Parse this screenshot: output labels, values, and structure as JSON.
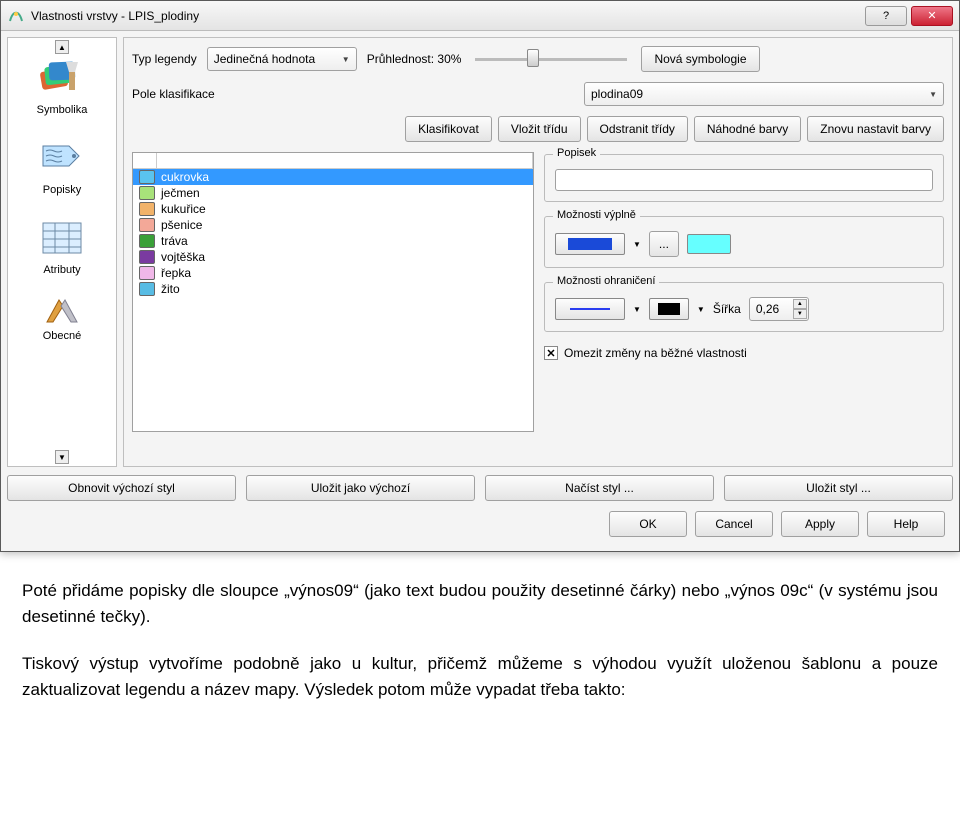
{
  "window": {
    "title": "Vlastnosti vrstvy - LPIS_plodiny",
    "help_glyph": "?",
    "close_glyph": "✕"
  },
  "sidebar": {
    "items": [
      {
        "label": "Symbolika"
      },
      {
        "label": "Popisky"
      },
      {
        "label": "Atributy"
      },
      {
        "label": "Obecné"
      }
    ]
  },
  "legend": {
    "type_label": "Typ legendy",
    "type_value": "Jedinečná hodnota",
    "transparency_label": "Průhlednost: 30%",
    "new_sym_btn": "Nová symbologie",
    "class_field_label": "Pole klasifikace",
    "class_field_value": "plodina09",
    "buttons": {
      "classify": "Klasifikovat",
      "add_class": "Vložit třídu",
      "remove_classes": "Odstranit třídy",
      "random_colors": "Náhodné barvy",
      "reset_colors": "Znovu nastavit barvy"
    },
    "classes": [
      {
        "label": "cukrovka",
        "color": "#5ac3ee"
      },
      {
        "label": "ječmen",
        "color": "#a8e27a"
      },
      {
        "label": "kukuřice",
        "color": "#f2b36a"
      },
      {
        "label": "pšenice",
        "color": "#f3a898"
      },
      {
        "label": "tráva",
        "color": "#3aa038"
      },
      {
        "label": "vojtěška",
        "color": "#7a3aa0"
      },
      {
        "label": "řepka",
        "color": "#f0b7e8"
      },
      {
        "label": "žito",
        "color": "#58bce4"
      }
    ]
  },
  "detail": {
    "popisek_label": "Popisek",
    "fill_label": "Možnosti výplně",
    "fill_color": "#1a4ad8",
    "fill_more": "...",
    "fill_preview": "#66ffff",
    "outline_label": "Možnosti ohraničení",
    "outline_color": "#2a3df0",
    "width_label": "Šířka",
    "width_value": "0,26",
    "black_swatch": "#000000",
    "limit_label": "Omezit změny na běžné vlastnosti"
  },
  "style_buttons": {
    "restore": "Obnovit výchozí styl",
    "save_default": "Uložit jako výchozí",
    "load": "Načíst styl ...",
    "save": "Uložit styl ..."
  },
  "dialog_buttons": {
    "ok": "OK",
    "cancel": "Cancel",
    "apply": "Apply",
    "help": "Help"
  },
  "doc": {
    "p1": "Poté přidáme popisky dle sloupce „výnos09“ (jako text budou použity desetinné čárky) nebo „výnos 09c“ (v systému jsou desetinné tečky).",
    "p2": "Tiskový výstup vytvoříme podobně jako u kultur, přičemž můžeme s výhodou využít uloženou šablonu a pouze zaktualizovat legendu a název mapy. Výsledek potom může vypadat třeba takto:"
  }
}
